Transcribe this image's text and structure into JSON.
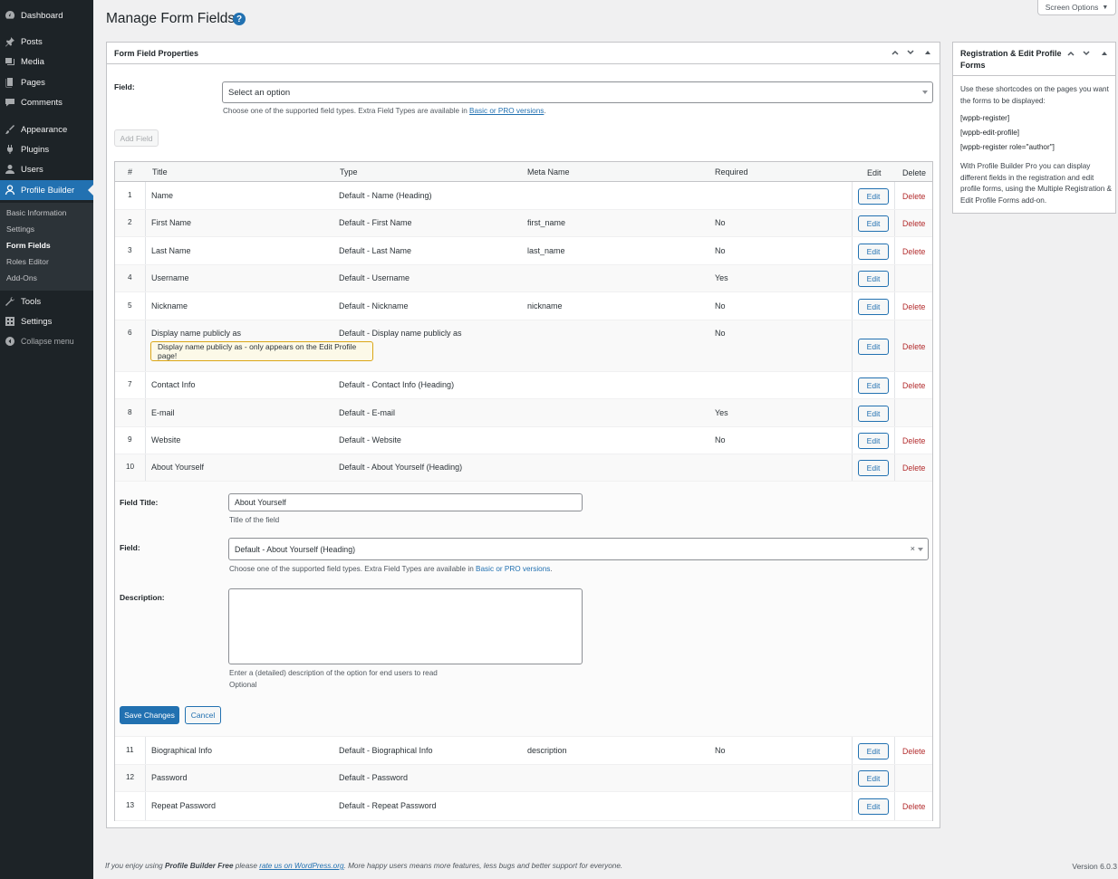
{
  "sidebar": {
    "items": [
      {
        "label": "Dashboard",
        "icon": "dashboard-icon"
      },
      {
        "label": "Posts",
        "icon": "pin-icon"
      },
      {
        "label": "Media",
        "icon": "media-icon"
      },
      {
        "label": "Pages",
        "icon": "pages-icon"
      },
      {
        "label": "Comments",
        "icon": "comment-icon"
      },
      {
        "label": "Appearance",
        "icon": "brush-icon"
      },
      {
        "label": "Plugins",
        "icon": "plug-icon"
      },
      {
        "label": "Users",
        "icon": "user-icon"
      },
      {
        "label": "Profile Builder",
        "icon": "profile-icon"
      },
      {
        "label": "Tools",
        "icon": "wrench-icon"
      },
      {
        "label": "Settings",
        "icon": "settings-icon"
      },
      {
        "label": "Collapse menu",
        "icon": "collapse-icon"
      }
    ],
    "submenu": [
      "Basic Information",
      "Settings",
      "Form Fields",
      "Roles Editor",
      "Add-Ons"
    ]
  },
  "header": {
    "title": "Manage Form Fields",
    "help": "?",
    "screen_options": "Screen Options"
  },
  "main_box": {
    "title": "Form Field Properties",
    "field_label": "Field:",
    "field_placeholder": "Select an option",
    "help_prefix": "Choose one of the supported field types. Extra Field Types are available in ",
    "help_link": "Basic or PRO versions",
    "help_suffix": ".",
    "add_field": "Add Field"
  },
  "table": {
    "headers": [
      "#",
      "Title",
      "Type",
      "Meta Name",
      "Required",
      "Edit",
      "Delete"
    ],
    "edit_label": "Edit",
    "delete_label": "Delete",
    "rows": [
      {
        "num": "1",
        "title": "Name",
        "type": "Default - Name (Heading)",
        "meta": "",
        "required": "",
        "delete": true
      },
      {
        "num": "2",
        "title": "First Name",
        "type": "Default - First Name",
        "meta": "first_name",
        "required": "No",
        "delete": true
      },
      {
        "num": "3",
        "title": "Last Name",
        "type": "Default - Last Name",
        "meta": "last_name",
        "required": "No",
        "delete": true
      },
      {
        "num": "4",
        "title": "Username",
        "type": "Default - Username",
        "meta": "",
        "required": "Yes",
        "delete": false
      },
      {
        "num": "5",
        "title": "Nickname",
        "type": "Default - Nickname",
        "meta": "nickname",
        "required": "No",
        "delete": true
      },
      {
        "num": "6",
        "title": "Display name publicly as",
        "type": "Default - Display name publicly as",
        "meta": "",
        "required": "No",
        "delete": true,
        "note": "Display name publicly as - only appears on the Edit Profile page!"
      },
      {
        "num": "7",
        "title": "Contact Info",
        "type": "Default - Contact Info (Heading)",
        "meta": "",
        "required": "",
        "delete": true
      },
      {
        "num": "8",
        "title": "E-mail",
        "type": "Default - E-mail",
        "meta": "",
        "required": "Yes",
        "delete": false
      },
      {
        "num": "9",
        "title": "Website",
        "type": "Default - Website",
        "meta": "",
        "required": "No",
        "delete": true
      },
      {
        "num": "10",
        "title": "About Yourself",
        "type": "Default - About Yourself (Heading)",
        "meta": "",
        "required": "",
        "delete": true
      },
      {
        "num": "11",
        "title": "Biographical Info",
        "type": "Default - Biographical Info",
        "meta": "description",
        "required": "No",
        "delete": true
      },
      {
        "num": "12",
        "title": "Password",
        "type": "Default - Password",
        "meta": "",
        "required": "",
        "delete": false
      },
      {
        "num": "13",
        "title": "Repeat Password",
        "type": "Default - Repeat Password",
        "meta": "",
        "required": "",
        "delete": true
      }
    ]
  },
  "edit_panel": {
    "field_title_label": "Field Title:",
    "field_title_value": "About Yourself",
    "field_title_help": "Title of the field",
    "field_label": "Field:",
    "field_value": "Default - About Yourself (Heading)",
    "field_clear": "×",
    "field_help_prefix": "Choose one of the supported field types. Extra Field Types are available in ",
    "field_help_link": "Basic or PRO versions",
    "field_help_suffix": ".",
    "description_label": "Description:",
    "description_value": "",
    "description_help": "Enter a (detailed) description of the option for end users to read",
    "description_optional": "Optional",
    "save": "Save Changes",
    "cancel": "Cancel"
  },
  "side_box": {
    "title": "Registration & Edit Profile Forms",
    "intro": "Use these shortcodes on the pages you want the forms to be displayed:",
    "shortcodes": [
      "[wppb-register]",
      "[wppb-edit-profile]",
      "[wppb-register role=\"author\"]"
    ],
    "outro": "With Profile Builder Pro you can display different fields in the registration and edit profile forms, using the Multiple Registration & Edit Profile Forms add-on."
  },
  "footer": {
    "prefix": "If you enjoy using ",
    "plugin": "Profile Builder Free",
    "middle": " please ",
    "link": "rate us on WordPress.org",
    "suffix": ". More happy users means more features, less bugs and better support for everyone.",
    "version": "Version 6.0.3"
  },
  "colors": {
    "accent": "#2271b1",
    "sidebar": "#1d2327",
    "delete": "#b32d2e",
    "note_bg": "#fcf9e8",
    "note_border": "#dba617"
  }
}
